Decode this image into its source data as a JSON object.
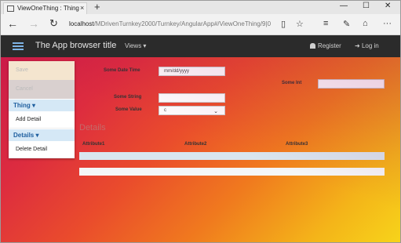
{
  "browser": {
    "tab_title": "ViewOneThing : Thing",
    "close_glyph": "×",
    "new_tab_glyph": "+",
    "url_host": "localhost",
    "url_path": "/MDrivenTurnkey2000/Turnkey/AngularApp#/ViewOneThing/9|0"
  },
  "app": {
    "title": "The App browser title",
    "views_label": "Views",
    "register_label": "Register",
    "login_label": "Log in"
  },
  "sidebar": {
    "save_label": "Save",
    "cancel_label": "Cancel",
    "thing_header": "Thing",
    "add_detail_label": "Add Detail",
    "details_header": "Details",
    "delete_detail_label": "Delete Detail"
  },
  "form": {
    "some_date_time_label": "Some Date Time",
    "date_placeholder": "mm/dd/yyyy",
    "some_int_label": "Some Int",
    "some_string_label": "Some String",
    "some_value_label": "Some Value",
    "some_value_selected": "c"
  },
  "details": {
    "title": "Details",
    "columns": [
      "Attribute1",
      "Attribute2",
      "Attribute3"
    ]
  }
}
